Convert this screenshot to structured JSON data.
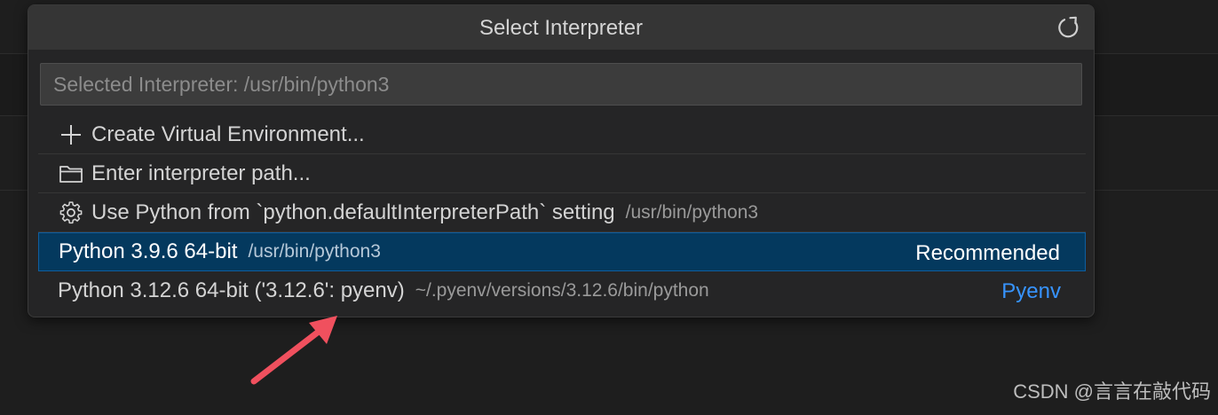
{
  "quick_pick": {
    "title": "Select Interpreter",
    "refresh_icon": "refresh-icon",
    "input": {
      "placeholder": "Selected Interpreter: /usr/bin/python3",
      "value": ""
    },
    "items": [
      {
        "icon": "plus-icon",
        "label": "Create Virtual Environment...",
        "description": "",
        "tag": ""
      },
      {
        "icon": "folder-icon",
        "label": "Enter interpreter path...",
        "description": "",
        "tag": ""
      },
      {
        "icon": "gear-icon",
        "label": "Use Python from `python.defaultInterpreterPath` setting",
        "description": "/usr/bin/python3",
        "tag": ""
      },
      {
        "icon": "",
        "label": "Python 3.9.6 64-bit",
        "description": "/usr/bin/python3",
        "tag": "Recommended",
        "selected": true
      },
      {
        "icon": "",
        "label": "Python 3.12.6 64-bit ('3.12.6': pyenv)",
        "description": "~/.pyenv/versions/3.12.6/bin/python",
        "tag": "Pyenv"
      }
    ]
  },
  "annotation": {
    "arrow_color": "#f0505e"
  },
  "watermark": "CSDN @言言在敲代码",
  "colors": {
    "selection": "#04395e",
    "selection_border": "#0e5ea0",
    "accent_link": "#3794ff"
  }
}
